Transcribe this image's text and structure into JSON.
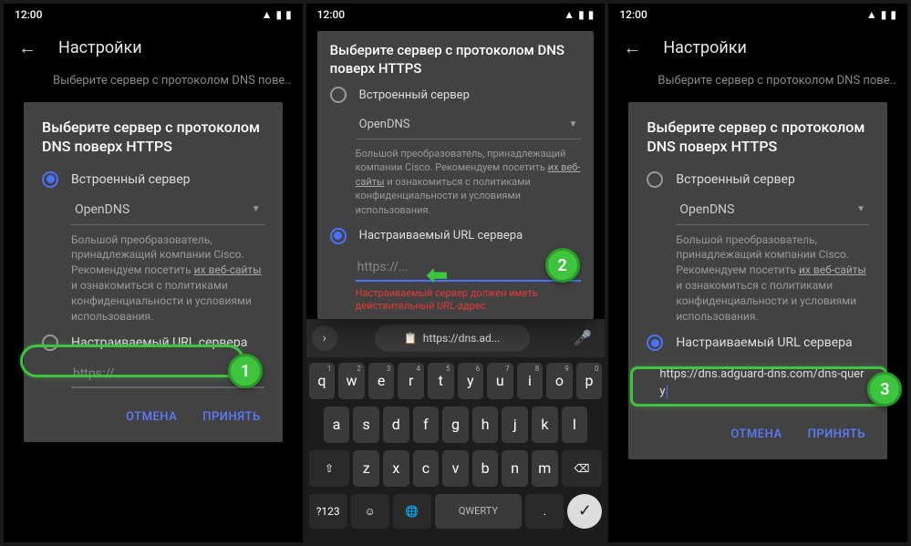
{
  "status": {
    "time": "12:00"
  },
  "header": {
    "title": "Настройки"
  },
  "subtitle": "Выберите сервер с протоколом DNS пове..",
  "dialog": {
    "title": "Выберите сервер с протоколом DNS поверх HTTPS",
    "opt_builtin": "Встроенный сервер",
    "dropdown_value": "OpenDNS",
    "desc_prefix": "Большой преобразователь, принадлежащий компании Cisco. Рекомендуем посетить ",
    "desc_link": "их веб-сайты",
    "desc_suffix": " и ознакомиться с политиками конфиденциальности и условиями использования.",
    "opt_custom": "Настраиваемый URL сервера",
    "url_placeholder": "https://...",
    "url_filled": "https://dns.adguard-dns.com/dns-query",
    "error": "Настраиваемый сервер должен иметь действительный URL-адрес",
    "btn_cancel": "ОТМЕНА",
    "btn_accept": "ПРИНЯТЬ"
  },
  "keyboard": {
    "suggestion": "https://dns.ad...",
    "row1": [
      "q",
      "w",
      "e",
      "r",
      "t",
      "y",
      "u",
      "i",
      "o",
      "p"
    ],
    "row1_sup": [
      "1",
      "2",
      "3",
      "4",
      "5",
      "6",
      "7",
      "8",
      "9",
      "0"
    ],
    "row2": [
      "a",
      "s",
      "d",
      "f",
      "g",
      "h",
      "j",
      "k",
      "l"
    ],
    "row3": [
      "z",
      "x",
      "c",
      "v",
      "b",
      "n",
      "m"
    ],
    "shift": "⇧",
    "backspace": "⌫",
    "numkey": "?123",
    "space": "QWERTY",
    "period": ".",
    "enter": "✓"
  },
  "steps": {
    "s1": "1",
    "s2": "2",
    "s3": "3"
  }
}
